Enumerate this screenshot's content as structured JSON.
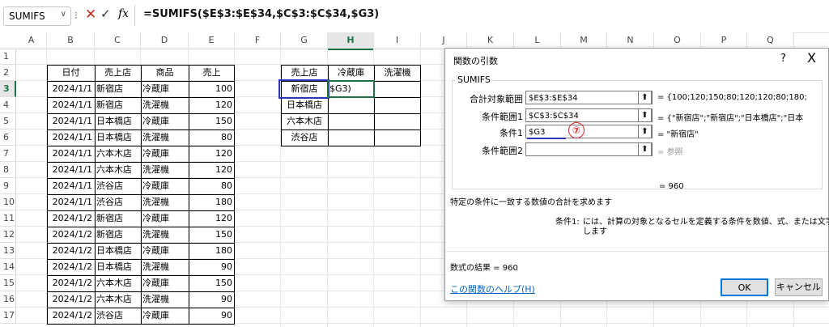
{
  "formula_bar": {
    "name_box": "SUMIFS",
    "formula": "=SUMIFS($E$3:$E$34,$C$3:$C$34,$G3)"
  },
  "columns": [
    "A",
    "B",
    "C",
    "D",
    "E",
    "F",
    "G",
    "H",
    "I",
    "J",
    "K",
    "L",
    "M",
    "N",
    "O",
    "P",
    "Q"
  ],
  "rows": [
    "1",
    "2",
    "3",
    "4",
    "5",
    "6",
    "7",
    "8",
    "9",
    "10",
    "11",
    "12",
    "13",
    "14",
    "15",
    "16",
    "17"
  ],
  "sales_table": {
    "headers": [
      "日付",
      "売上店",
      "商品",
      "売上"
    ],
    "rows": [
      [
        "2024/1/1",
        "新宿店",
        "冷蔵庫",
        "100"
      ],
      [
        "2024/1/1",
        "新宿店",
        "洗濯機",
        "120"
      ],
      [
        "2024/1/1",
        "日本橋店",
        "冷蔵庫",
        "150"
      ],
      [
        "2024/1/1",
        "日本橋店",
        "洗濯機",
        "80"
      ],
      [
        "2024/1/1",
        "六本木店",
        "冷蔵庫",
        "120"
      ],
      [
        "2024/1/1",
        "六本木店",
        "洗濯機",
        "120"
      ],
      [
        "2024/1/1",
        "渋谷店",
        "冷蔵庫",
        "80"
      ],
      [
        "2024/1/1",
        "渋谷店",
        "洗濯機",
        "180"
      ],
      [
        "2024/1/2",
        "新宿店",
        "冷蔵庫",
        "120"
      ],
      [
        "2024/1/2",
        "新宿店",
        "洗濯機",
        "150"
      ],
      [
        "2024/1/2",
        "日本橋店",
        "冷蔵庫",
        "180"
      ],
      [
        "2024/1/2",
        "日本橋店",
        "洗濯機",
        "90"
      ],
      [
        "2024/1/2",
        "六本木店",
        "冷蔵庫",
        "150"
      ],
      [
        "2024/1/2",
        "六本木店",
        "洗濯機",
        "90"
      ],
      [
        "2024/1/2",
        "渋谷店",
        "冷蔵庫",
        "90"
      ]
    ]
  },
  "summary_table": {
    "headers": [
      "売上店",
      "冷蔵庫",
      "洗濯機"
    ],
    "stores": [
      "新宿店",
      "日本橋店",
      "六本木店",
      "渋谷店"
    ],
    "editing_cell": "$G3)"
  },
  "dialog": {
    "title": "関数の引数",
    "help_q": "?",
    "close": "X",
    "function_name": "SUMIFS",
    "args": [
      {
        "label": "合計対象範囲",
        "value": "$E$3:$E$34",
        "result": "= {100;120;150;80;120;120;80;180;"
      },
      {
        "label": "条件範囲1",
        "value": "$C$3:$C$34",
        "result": "= {\"新宿店\";\"新宿店\";\"日本橋店\";\"日本"
      },
      {
        "label": "条件1",
        "value": "$G3",
        "result": "= \"新宿店\""
      },
      {
        "label": "条件範囲2",
        "value": "",
        "result": "= 参照"
      }
    ],
    "picker_glyph": "⬆",
    "annotation": "⑦",
    "total_result": "=  960",
    "description": "特定の条件に一致する数値の合計を求めます",
    "arg_help_label": "条件1:",
    "arg_help_line1": "には、計算の対象となるセルを定義する条件を数値、式、または文字列で指定",
    "arg_help_line2": "します",
    "formula_result": "数式の結果 =   960",
    "help_link": "この関数のヘルプ(H)",
    "ok": "OK",
    "cancel": "キャンセル"
  }
}
